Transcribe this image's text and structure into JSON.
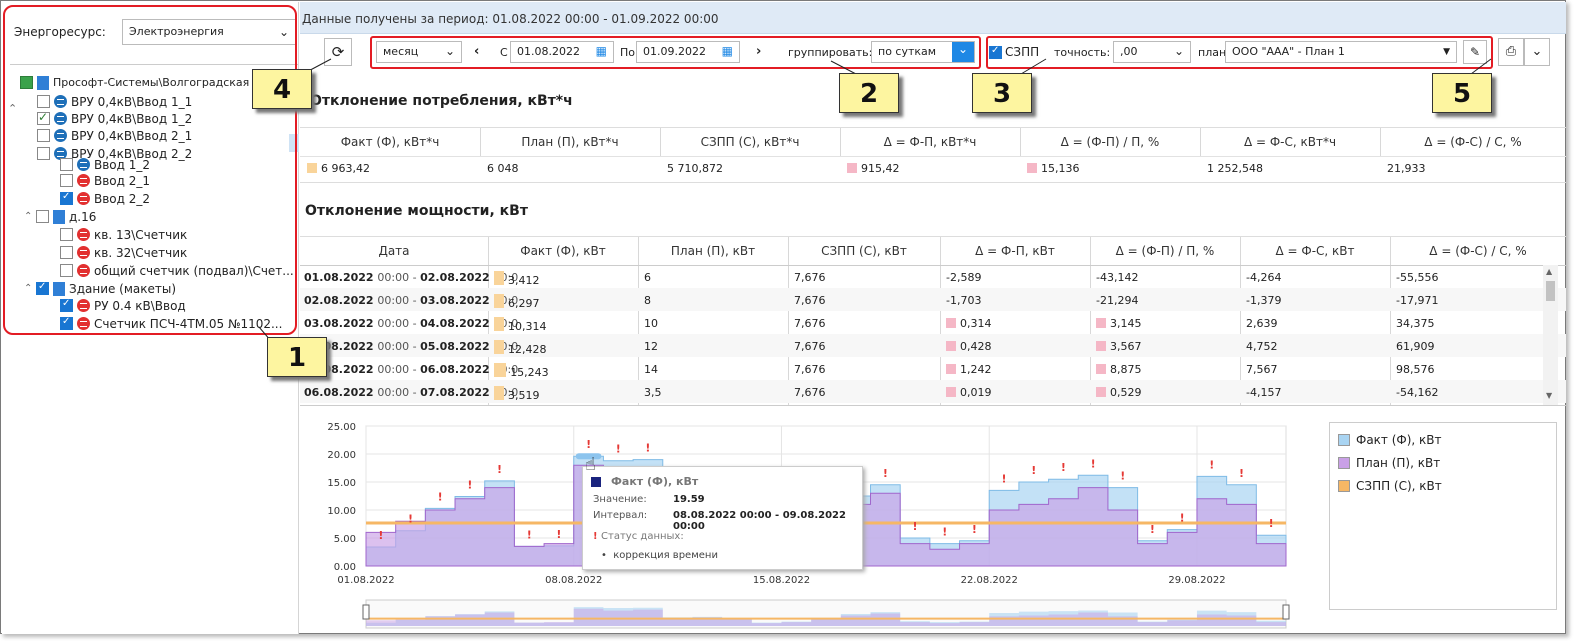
{
  "left": {
    "energy_label": "Энергоресурс:",
    "energy_value": "Электроэнергия",
    "tree": [
      {
        "label": "Прософт-Системы\\Волгоградская",
        "kind": "root"
      },
      {
        "label": "ВРУ 0,4кВ\\Ввод 1_1",
        "state": "off"
      },
      {
        "label": "ВРУ 0,4кВ\\Ввод 1_2",
        "state": "green"
      },
      {
        "label": "ВРУ 0,4кВ\\Ввод 2_1",
        "state": "off"
      },
      {
        "label": "ВРУ 0,4кВ\\Ввод 2_2",
        "state": "off"
      },
      {
        "label": "Ввод 1_2",
        "state": "partial"
      },
      {
        "label": "Ввод 2_1",
        "state": "off"
      },
      {
        "label": "Ввод 2_2",
        "state": "on"
      },
      {
        "label": "д.16",
        "state": "off"
      },
      {
        "label": "кв. 13\\Счетчик",
        "state": "off"
      },
      {
        "label": "кв. 32\\Счетчик",
        "state": "off"
      },
      {
        "label": "общий счетчик (подвал)\\Счет...",
        "state": "off"
      },
      {
        "label": "Здание (макеты)",
        "state": "on"
      },
      {
        "label": "РУ 0.4 кВ\\Ввод",
        "state": "on"
      },
      {
        "label": "Счетчик ПСЧ-4ТМ.05 №1102...",
        "state": "on"
      }
    ]
  },
  "header": {
    "period_text": "Данные получены за период: 01.08.2022 00:00 - 01.09.2022 00:00"
  },
  "toolbar": {
    "period": "месяц",
    "from_label": "С",
    "from_date": "01.08.2022",
    "to_label": "По",
    "to_date": "01.09.2022",
    "group_label": "группировать:",
    "group_value": "по суткам",
    "szpp_label": "СЗПП",
    "precision_label": "точность:",
    "precision_value": ",00",
    "plan_label": "план:",
    "plan_value": "ООО \"ААА\" - План 1"
  },
  "callouts": [
    "1",
    "2",
    "3",
    "4",
    "5"
  ],
  "consumption": {
    "title": "Отклонение потребления, кВт*ч",
    "headers": [
      "Факт (Ф), кВт*ч",
      "План (П), кВт*ч",
      "СЗПП (С), кВт*ч",
      "Δ = Ф-П, кВт*ч",
      "Δ = (Ф-П) / П, %",
      "Δ = Ф-С, кВт*ч",
      "Δ = (Ф-С) / С, %"
    ],
    "values": [
      "6 963,42",
      "6 048",
      "5 710,872",
      "915,42",
      "15,136",
      "1 252,548",
      "21,933"
    ]
  },
  "power": {
    "title": "Отклонение мощности, кВт",
    "headers": [
      "Дата",
      "Факт (Ф), кВт",
      "План (П), кВт",
      "СЗПП (С), кВт",
      "Δ = Ф-П, кВт",
      "Δ = (Ф-П) / П, %",
      "Δ = Ф-С, кВт",
      "Δ = (Ф-С) / С, %"
    ],
    "rows": [
      {
        "d1": "01.08.2022",
        "t1": "00:00 -",
        "d2": "02.08.2022",
        "t2": "00:0",
        "f": "3,412",
        "p": "6",
        "c": "7,676",
        "dfp": "-2,589",
        "dfpp": "-43,142",
        "dfc": "-4,264",
        "dfcp": "-55,556"
      },
      {
        "d1": "02.08.2022",
        "t1": "00:00 -",
        "d2": "03.08.2022",
        "t2": "00:0",
        "f": "6,297",
        "p": "8",
        "c": "7,676",
        "dfp": "-1,703",
        "dfpp": "-21,294",
        "dfc": "-1,379",
        "dfcp": "-17,971"
      },
      {
        "d1": "03.08.2022",
        "t1": "00:00 -",
        "d2": "04.08.2022",
        "t2": "00:0",
        "f": "10,314",
        "p": "10",
        "c": "7,676",
        "dfp": "0,314",
        "dfpp": "3,145",
        "dfc": "2,639",
        "dfcp": "34,375"
      },
      {
        "d1": "04.08.2022",
        "t1": "00:00 -",
        "d2": "05.08.2022",
        "t2": "00:0",
        "f": "12,428",
        "p": "12",
        "c": "7,676",
        "dfp": "0,428",
        "dfpp": "3,567",
        "dfc": "4,752",
        "dfcp": "61,909"
      },
      {
        "d1": "05.08.2022",
        "t1": "00:00 -",
        "d2": "06.08.2022",
        "t2": "00:0",
        "f": "15,243",
        "p": "14",
        "c": "7,676",
        "dfp": "1,242",
        "dfpp": "8,875",
        "dfc": "7,567",
        "dfcp": "98,576"
      },
      {
        "d1": "06.08.2022",
        "t1": "00:00 -",
        "d2": "07.08.2022",
        "t2": "00:0",
        "f": "3,519",
        "p": "3,5",
        "c": "7,676",
        "dfp": "0,019",
        "dfpp": "0,529",
        "dfc": "-4,157",
        "dfcp": "-54,162"
      }
    ]
  },
  "chart_data": {
    "type": "area",
    "x": [
      "01.08",
      "02.08",
      "03.08",
      "04.08",
      "05.08",
      "06.08",
      "07.08",
      "08.08",
      "09.08",
      "10.08",
      "11.08",
      "12.08",
      "13.08",
      "14.08",
      "15.08",
      "16.08",
      "17.08",
      "18.08",
      "19.08",
      "20.08",
      "21.08",
      "22.08",
      "23.08",
      "24.08",
      "25.08",
      "26.08",
      "27.08",
      "28.08",
      "29.08",
      "30.08",
      "31.08"
    ],
    "xticks": [
      "01.08.2022",
      "08.08.2022",
      "15.08.2022",
      "22.08.2022",
      "29.08.2022"
    ],
    "yticks": [
      "0.00",
      "5.00",
      "10.00",
      "15.00",
      "20.00",
      "25.00"
    ],
    "ylim": [
      0,
      25
    ],
    "series": [
      {
        "name": "Факт (Ф), кВт",
        "color": "#a9d4f2",
        "values": [
          3.4,
          6.3,
          10.3,
          12.4,
          15.2,
          3.5,
          3.6,
          19.6,
          18.8,
          19.0,
          9.0,
          9.5,
          8.0,
          3.5,
          4.6,
          8.5,
          12.5,
          14.5,
          5.0,
          4.0,
          4.5,
          13.5,
          15.0,
          15.5,
          16.2,
          14.0,
          4.5,
          6.5,
          16.0,
          14.5,
          5.5
        ]
      },
      {
        "name": "План (П), кВт",
        "color": "#c9a0e6",
        "values": [
          6,
          8,
          10,
          12,
          14,
          3.5,
          4,
          18,
          16,
          17,
          8,
          9,
          7,
          3,
          4,
          7,
          11,
          13,
          4,
          3,
          4,
          10,
          11,
          12,
          14,
          10,
          4,
          6,
          12,
          11,
          4
        ]
      },
      {
        "name": "СЗПП (С), кВт",
        "color": "#f6b765",
        "values": [
          7.676,
          7.676,
          7.676,
          7.676,
          7.676,
          7.676,
          7.676,
          7.676,
          7.676,
          7.676,
          7.676,
          7.676,
          7.676,
          7.676,
          7.676,
          7.676,
          7.676,
          7.676,
          7.676,
          7.676,
          7.676,
          7.676,
          7.676,
          7.676,
          7.676,
          7.676,
          7.676,
          7.676,
          7.676,
          7.676,
          7.676
        ]
      }
    ],
    "legend_position": "right",
    "tooltip": {
      "title": "Факт (Ф), кВт",
      "value_label": "Значение:",
      "value": "19.59",
      "interval_label": "Интервал:",
      "interval": "08.08.2022 00:00 - 09.08.2022 00:00",
      "status_label": "Статус данных:",
      "status_item": "коррекция времени"
    }
  }
}
